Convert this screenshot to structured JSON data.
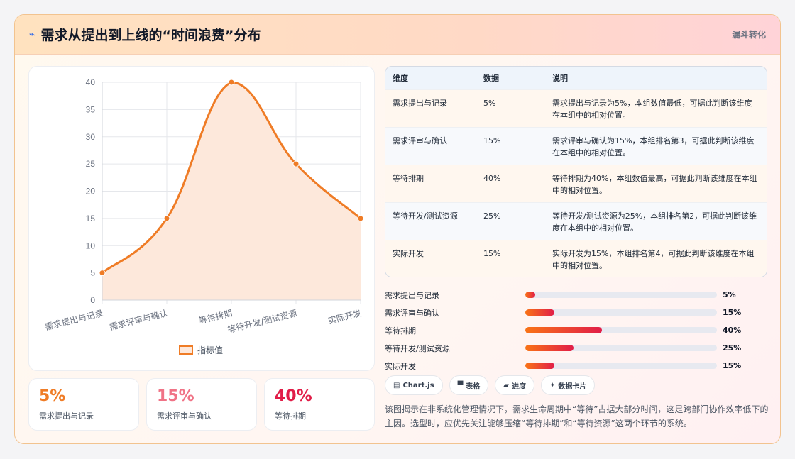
{
  "header": {
    "title": "需求从提出到上线的“时间浪费”分布",
    "tag": "漏斗转化"
  },
  "colors": {
    "line": "#ef7c26",
    "area": "#fde8db",
    "stat": [
      "#ef7c26",
      "#f07386",
      "#e11d48"
    ]
  },
  "chart_data": {
    "type": "line",
    "categories": [
      "需求提出与记录",
      "需求评审与确认",
      "等待排期",
      "等待开发/测试资源",
      "实际开发"
    ],
    "series": [
      {
        "name": "指标值",
        "values": [
          5,
          15,
          40,
          25,
          15
        ]
      }
    ],
    "ylim": [
      0,
      40
    ],
    "yticks": [
      0,
      5,
      10,
      15,
      20,
      25,
      30,
      35,
      40
    ],
    "fill": true,
    "grid": true,
    "legend": "bottom"
  },
  "stats": [
    {
      "value": "5%",
      "label": "需求提出与记录"
    },
    {
      "value": "15%",
      "label": "需求评审与确认"
    },
    {
      "value": "40%",
      "label": "等待排期"
    }
  ],
  "table": {
    "headers": [
      "维度",
      "数据",
      "说明"
    ],
    "rows": [
      [
        "需求提出与记录",
        "5%",
        "需求提出与记录为5%，本组数值最低，可据此判断该维度在本组中的相对位置。"
      ],
      [
        "需求评审与确认",
        "15%",
        "需求评审与确认为15%，本组排名第3，可据此判断该维度在本组中的相对位置。"
      ],
      [
        "等待排期",
        "40%",
        "等待排期为40%，本组数值最高，可据此判断该维度在本组中的相对位置。"
      ],
      [
        "等待开发/测试资源",
        "25%",
        "等待开发/测试资源为25%，本组排名第2，可据此判断该维度在本组中的相对位置。"
      ],
      [
        "实际开发",
        "15%",
        "实际开发为15%，本组排名第4，可据此判断该维度在本组中的相对位置。"
      ]
    ]
  },
  "progress": [
    {
      "label": "需求提出与记录",
      "value": "5%",
      "fraction": 0.05
    },
    {
      "label": "需求评审与确认",
      "value": "15%",
      "fraction": 0.15
    },
    {
      "label": "等待排期",
      "value": "40%",
      "fraction": 0.4
    },
    {
      "label": "等待开发/测试资源",
      "value": "25%",
      "fraction": 0.25
    },
    {
      "label": "实际开发",
      "value": "15%",
      "fraction": 0.15
    }
  ],
  "chips": [
    {
      "icon": "▤",
      "icon_name": "chart-icon",
      "label": "Chart.js"
    },
    {
      "icon": "▀",
      "icon_name": "table-icon",
      "label": "表格"
    },
    {
      "icon": "▰",
      "icon_name": "progress-icon",
      "label": "进度"
    },
    {
      "icon": "✦",
      "icon_name": "sparkle-icon",
      "label": "数据卡片"
    }
  ],
  "description": "该图揭示在非系统化管理情况下，需求生命周期中“等待”占据大部分时间，这是跨部门协作效率低下的主因。选型时，应优先关注能够压缩“等待排期”和“等待资源”这两个环节的系统。"
}
